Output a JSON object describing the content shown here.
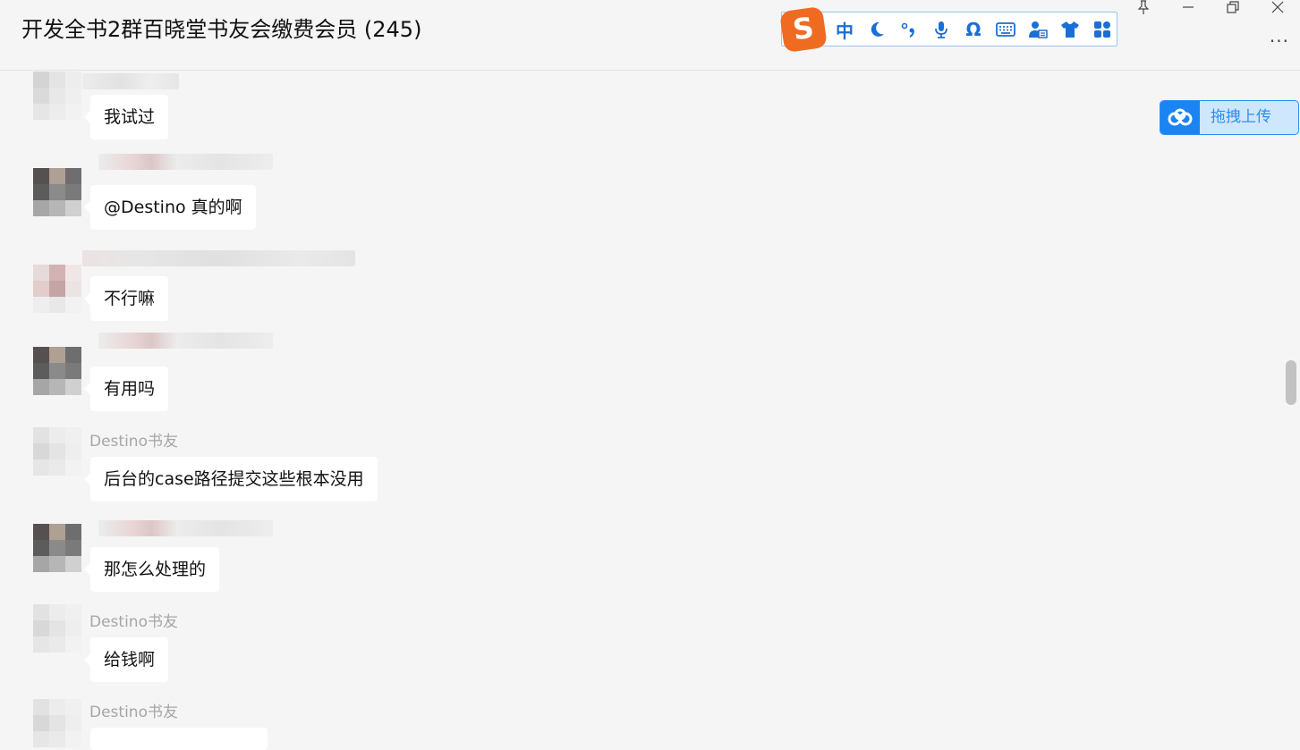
{
  "window": {
    "title": "开发全书2群百晓堂书友会缴费会员 (245)",
    "controls": {
      "pin": "⚲",
      "minimize": "—",
      "restore": "❐",
      "close": "✕",
      "more": "···"
    }
  },
  "ime_toolbar": {
    "logo": "S",
    "items": [
      {
        "name": "chinese-mode-icon",
        "glyph": "中"
      },
      {
        "name": "moon-icon",
        "glyph": "☾"
      },
      {
        "name": "punctuation-icon",
        "glyph": "°,"
      },
      {
        "name": "microphone-icon",
        "glyph": ""
      },
      {
        "name": "omega-icon",
        "glyph": "Ω"
      },
      {
        "name": "keyboard-icon",
        "glyph": ""
      },
      {
        "name": "user-card-icon",
        "glyph": ""
      },
      {
        "name": "shirt-icon",
        "glyph": ""
      },
      {
        "name": "apps-icon",
        "glyph": ""
      }
    ],
    "accent": "#1a6fd6",
    "logo_color": "#f06b22"
  },
  "upload_button": {
    "label": "拖拽上传",
    "icon": "baidu-cloud-icon"
  },
  "messages": [
    {
      "sender": "",
      "text": "我试过"
    },
    {
      "sender": "",
      "text": "@Destino 真的啊"
    },
    {
      "sender": "",
      "text": "不行嘛"
    },
    {
      "sender": "",
      "text": "有用吗"
    },
    {
      "sender": "Destino书友",
      "text": "后台的case路径提交这些根本没用"
    },
    {
      "sender": "",
      "text": "那怎么处理的"
    },
    {
      "sender": "Destino书友",
      "text": "给钱啊"
    },
    {
      "sender": "Destino书友",
      "text": ""
    }
  ]
}
